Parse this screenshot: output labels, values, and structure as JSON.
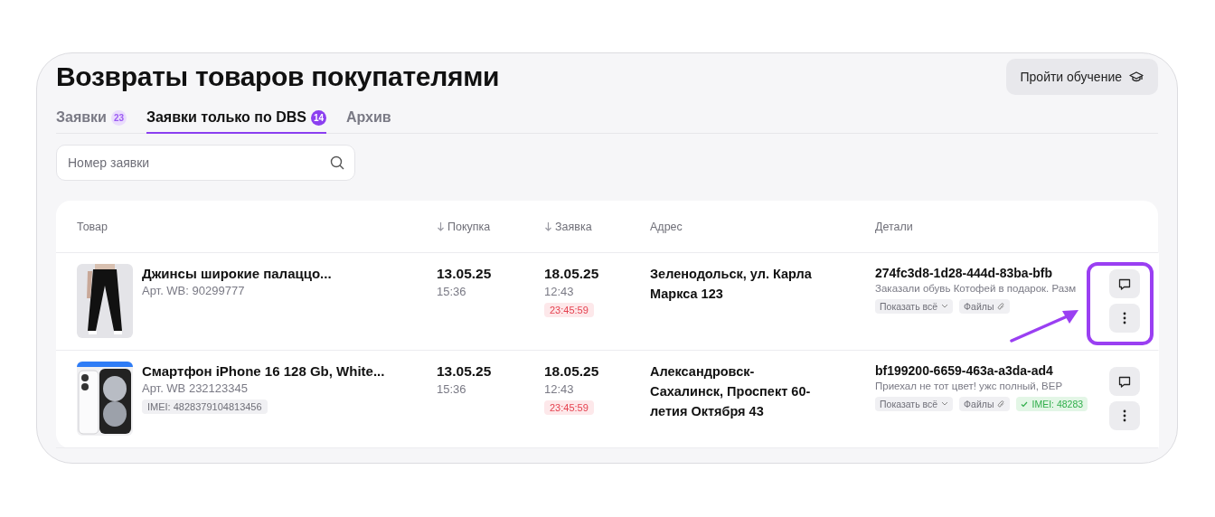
{
  "title": "Возвраты товаров покупателями",
  "tutorial_button": {
    "label": "Пройти обучение"
  },
  "tabs": [
    {
      "label": "Заявки",
      "count": "23",
      "selected": false
    },
    {
      "label": "Заявки только по DBS",
      "count": "14",
      "selected": true
    },
    {
      "label": "Архив",
      "selected": false
    }
  ],
  "search": {
    "placeholder": "Номер заявки"
  },
  "table": {
    "columns": [
      {
        "label": "Товар",
        "sorted": false
      },
      {
        "label": "Покупка",
        "sorted": true
      },
      {
        "label": "Заявка",
        "sorted": true
      },
      {
        "label": "Адрес",
        "sorted": false
      },
      {
        "label": "Детали",
        "sorted": false
      }
    ],
    "rows": [
      {
        "product": {
          "kind": "jeans",
          "name": "Джинсы широкие палаццо...",
          "article": "Арт. WB: 90299777"
        },
        "purchase": {
          "date": "13.05.25",
          "time": "15:36"
        },
        "request": {
          "date": "18.05.25",
          "time": "12:43",
          "timer": "23:45:59"
        },
        "address": "Зеленодольск,  ул. Карла Маркса 123",
        "details": {
          "id": "274fc3d8-1d28-444d-83ba-bfb",
          "comment": "Заказали обувь Котофей в подарок. Разм",
          "chips": [
            {
              "kind": "show_all",
              "label": "Показать всё"
            },
            {
              "kind": "files",
              "label": "Файлы"
            }
          ]
        },
        "highlighted": true
      },
      {
        "product": {
          "kind": "phone",
          "name": "Смартфон iPhone 16 128 Gb, White...",
          "article": "Арт. WB 232123345",
          "imei": "IMEI: 4828379104813456"
        },
        "purchase": {
          "date": "13.05.25",
          "time": "15:36"
        },
        "request": {
          "date": "18.05.25",
          "time": "12:43",
          "timer": "23:45:59"
        },
        "address": "Александровск-Сахалинск,  Проспект 60-летия Октября 43",
        "details": {
          "id": "bf199200-6659-463a-a3da-ad4",
          "comment": "Приехал не тот цвет! ужс полный, ВЕР",
          "chips": [
            {
              "kind": "show_all",
              "label": "Показать всё"
            },
            {
              "kind": "files",
              "label": "Файлы"
            },
            {
              "kind": "imei",
              "label": "IMEI: 48283"
            }
          ]
        },
        "highlighted": false
      }
    ]
  }
}
